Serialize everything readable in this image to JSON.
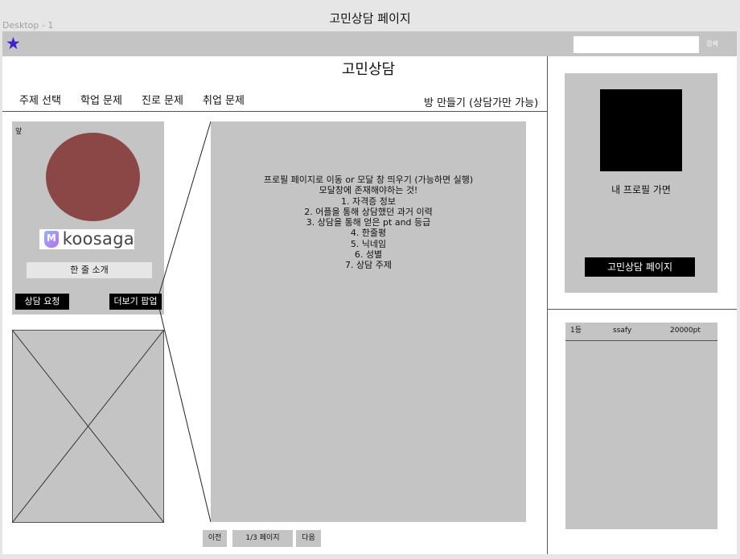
{
  "window": {
    "frame_label": "Desktop - 1",
    "page_title": "고민상담 페이지"
  },
  "topbar": {
    "star_icon": "star-icon",
    "search_placeholder": "",
    "search_label": "검색"
  },
  "main": {
    "title": "고민상담",
    "nav": [
      {
        "label": "주제 선택"
      },
      {
        "label": "학업 문제"
      },
      {
        "label": "진로 문제"
      },
      {
        "label": "취업 문제"
      }
    ],
    "create_room_label": "방 만들기 (상담가만 가능)"
  },
  "profile_card": {
    "tag": "앞",
    "logo_mark": "M",
    "logo_text": "koosaga",
    "one_line_intro": "한 줄 소개",
    "request_button": "상담 요청",
    "more_popup_button": "더보기 팝업"
  },
  "modal_panel": {
    "lines": [
      "프로필 페이지로 이동 or 모달 창 띄우기 (가능하면 실행)",
      "모달창에 존재해야하는 것!",
      "1. 자격증 정보",
      "2. 어플을 통해 상담했던 과거 이력",
      "3. 상담을 통해 얻은 pt and 등급",
      "4. 한줄평",
      "5. 닉네임",
      "6. 성별",
      "7. 상담 주제"
    ]
  },
  "pager": {
    "prev": "이전",
    "page": "1/3 페이지",
    "next": "다음"
  },
  "my_profile": {
    "label": "내 프로필 가면",
    "button": "고민상담 페이지"
  },
  "ranking": {
    "rows": [
      {
        "rank": "1등",
        "name": "ssafy",
        "points": "20000pt"
      }
    ]
  },
  "colors": {
    "avatar": "#8b4646",
    "star": "#3a23c9",
    "panel_gray": "#c4c4c4"
  }
}
